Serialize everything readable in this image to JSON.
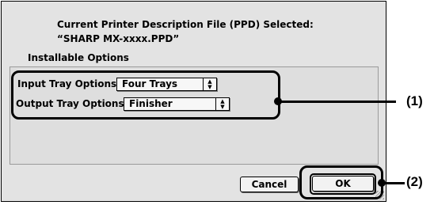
{
  "dialog": {
    "ppd_heading": "Current Printer Description File (PPD) Selected:",
    "ppd_name": "“SHARP MX-xxxx.PPD”",
    "section_title": "Installable Options",
    "options": [
      {
        "label": "Input Tray Options:",
        "value": "Four Trays"
      },
      {
        "label": "Output Tray Options:",
        "value": "Finisher"
      }
    ],
    "buttons": {
      "cancel": "Cancel",
      "ok": "OK"
    }
  },
  "callouts": {
    "first": "(1)",
    "second": "(2)"
  },
  "icons": {
    "popup_arrows": "up-down-arrows-icon",
    "resize": "resize-grip-icon"
  }
}
